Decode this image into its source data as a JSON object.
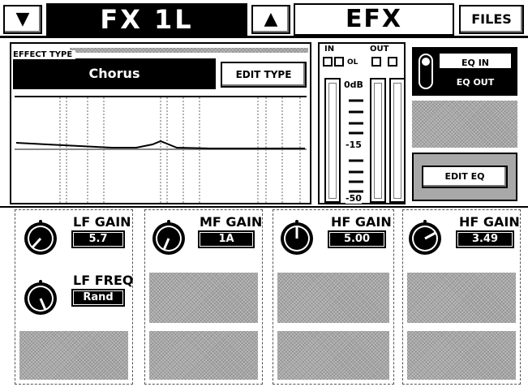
{
  "header": {
    "prev_arrow": "▼",
    "channel_title": "FX 1L",
    "up_arrow": "▲",
    "mode_title": "EFX",
    "files_label": "FILES"
  },
  "effect": {
    "section_label": "EFFECT TYPE",
    "type_value": "Chorus",
    "edit_type_label": "EDIT TYPE"
  },
  "meters": {
    "in_label": "IN",
    "out_label": "OUT",
    "ol_label": "OL",
    "scale_0": "0dB",
    "scale_15": "-15",
    "scale_50": "-50"
  },
  "eq": {
    "eq_in_label": "EQ IN",
    "eq_out_label": "EQ OUT",
    "edit_eq_label": "EDIT EQ"
  },
  "params": [
    {
      "label": "LF GAIN",
      "value": "5.7"
    },
    {
      "label": "MF GAIN",
      "value": "1A"
    },
    {
      "label": "HF GAIN",
      "value": "5.00"
    },
    {
      "label": "HF GAIN",
      "value": "3.49"
    }
  ],
  "params2": [
    {
      "label": "LF FREQ",
      "value": "Rand"
    }
  ]
}
